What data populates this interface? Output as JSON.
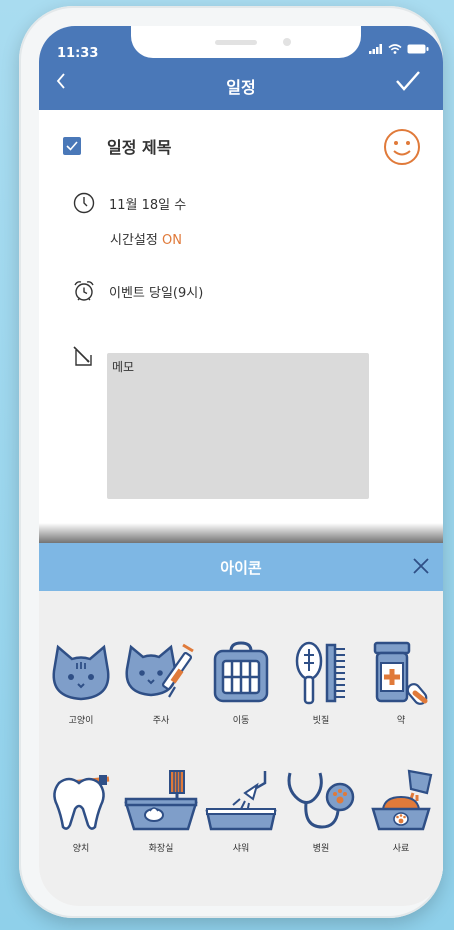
{
  "status": {
    "time": "11:33"
  },
  "header": {
    "title": "일정"
  },
  "event": {
    "title": "일정 제목",
    "date": "11월 18일 수",
    "time_setting_label": "시간설정",
    "time_setting_value": "ON",
    "alarm": "이벤트 당일(9시)",
    "memo_placeholder": "메모"
  },
  "icon_sheet": {
    "title": "아이콘",
    "icons": [
      {
        "label": "고양이",
        "icon": "cat-icon"
      },
      {
        "label": "주사",
        "icon": "injection-icon"
      },
      {
        "label": "이동",
        "icon": "carrier-icon"
      },
      {
        "label": "빗질",
        "icon": "brush-icon"
      },
      {
        "label": "약",
        "icon": "medicine-icon"
      },
      {
        "label": "양치",
        "icon": "tooth-icon"
      },
      {
        "label": "화장실",
        "icon": "litter-box-icon"
      },
      {
        "label": "샤워",
        "icon": "shower-icon"
      },
      {
        "label": "병원",
        "icon": "stethoscope-icon"
      },
      {
        "label": "사료",
        "icon": "food-bowl-icon"
      }
    ]
  },
  "colors": {
    "primary": "#4a78b8",
    "accent": "#e07a3a",
    "sheet_header": "#7eb7e4",
    "icon_fill": "#7f9ec9",
    "icon_stroke": "#2f4f86"
  }
}
